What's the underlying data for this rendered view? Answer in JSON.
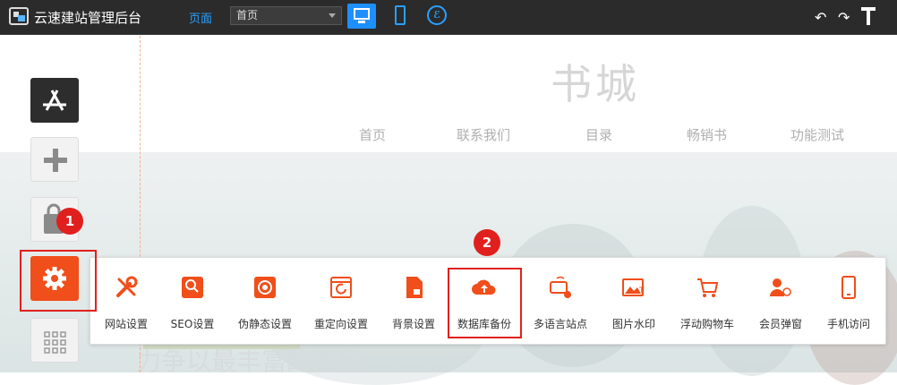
{
  "topbar": {
    "app_title": "云速建站管理后台",
    "page_label": "页面",
    "page_select_value": "首页",
    "icons": [
      "desktop-icon",
      "mobile-icon",
      "wechat-icon",
      "undo-icon",
      "redo-icon",
      "pin-icon"
    ]
  },
  "site": {
    "title": "书城",
    "nav": [
      "首页",
      "联系我们",
      "目录",
      "畅销书",
      "功能测试"
    ],
    "hero_caption": "力争以最丰富的选品"
  },
  "sidebar": {
    "buttons": [
      "app-store-icon",
      "add-icon",
      "bag-icon",
      "gear-icon",
      "grid-icon"
    ]
  },
  "callouts": [
    "1",
    "2"
  ],
  "panel": {
    "items": [
      {
        "label": "网站设置",
        "icon": "tools-icon"
      },
      {
        "label": "SEO设置",
        "icon": "seo-search-icon"
      },
      {
        "label": "伪静态设置",
        "icon": "rewrite-icon"
      },
      {
        "label": "重定向设置",
        "icon": "redirect-icon"
      },
      {
        "label": "背景设置",
        "icon": "background-icon"
      },
      {
        "label": "数据库备份",
        "icon": "cloud-upload-icon"
      },
      {
        "label": "多语言站点",
        "icon": "keyboard-gear-icon"
      },
      {
        "label": "图片水印",
        "icon": "image-watermark-icon"
      },
      {
        "label": "浮动购物车",
        "icon": "cart-icon"
      },
      {
        "label": "会员弹窗",
        "icon": "member-popup-icon"
      },
      {
        "label": "手机访问",
        "icon": "phone-icon"
      }
    ]
  },
  "colors": {
    "accent_orange": "#f04e1a",
    "highlight_red": "#e0201e",
    "topbar_bg": "#2b2b2b",
    "device_blue": "#1e8fff"
  }
}
